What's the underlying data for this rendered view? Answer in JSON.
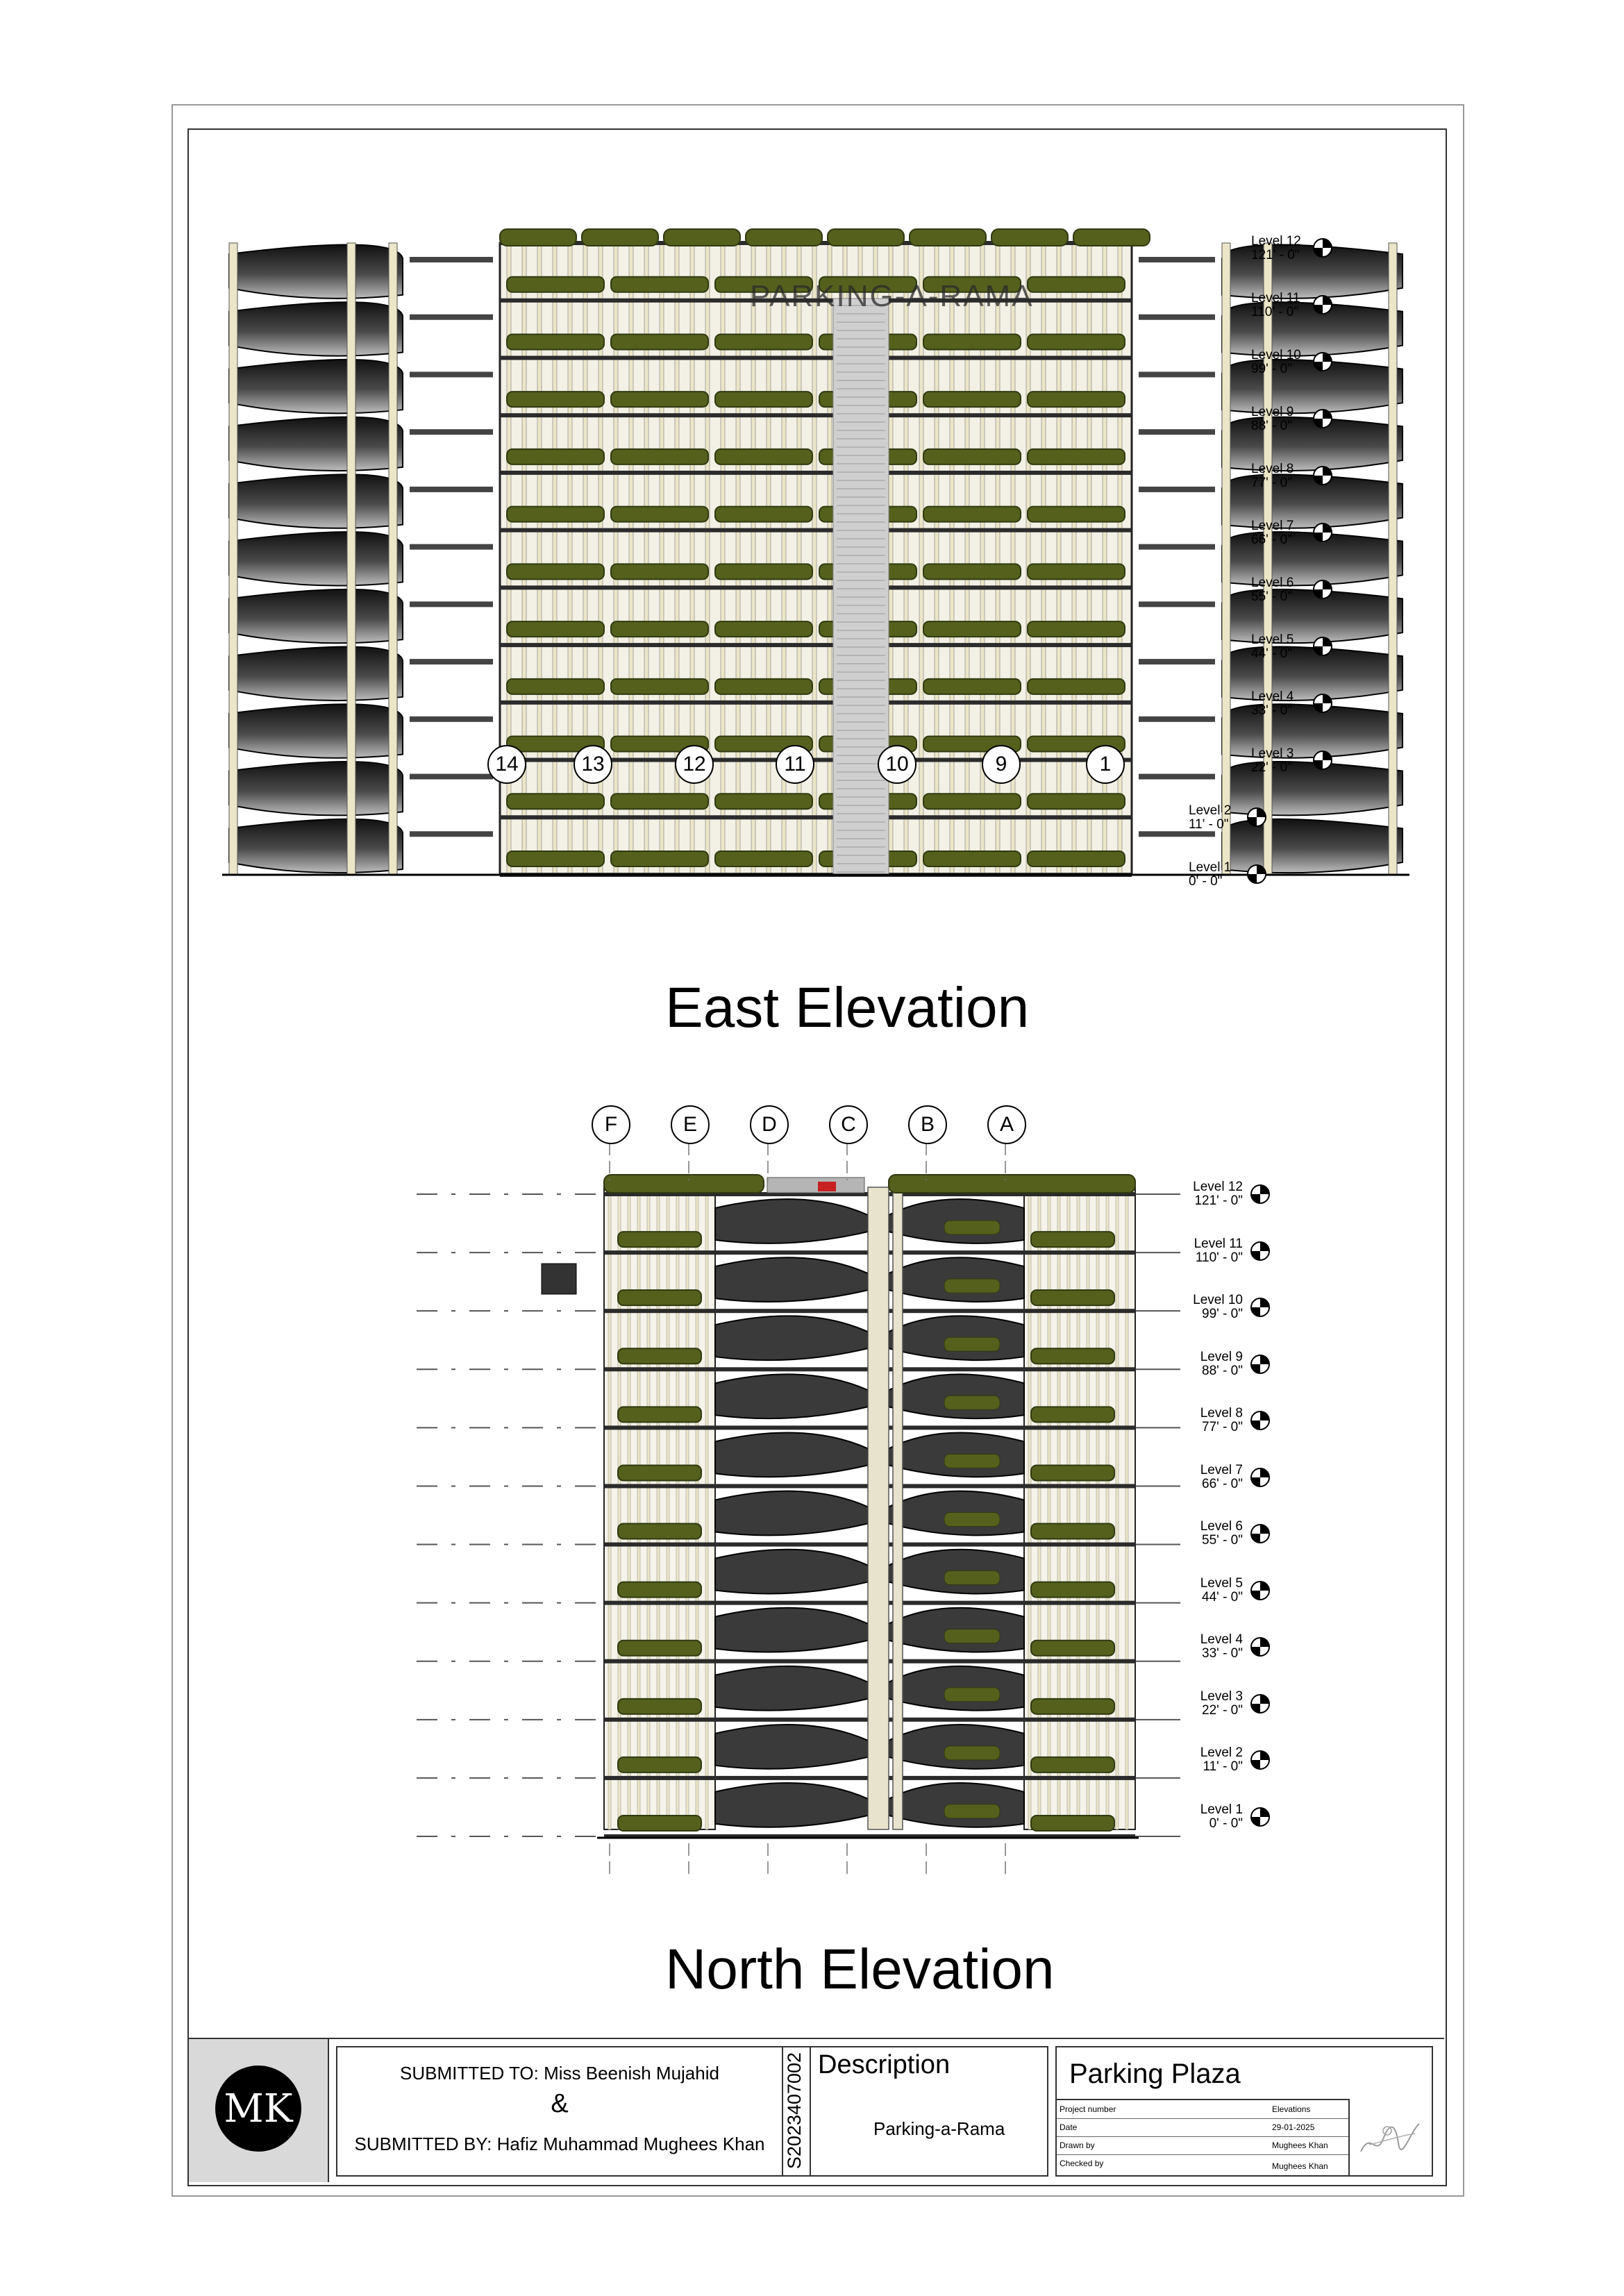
{
  "sheet": {
    "name": "Parking Plaza"
  },
  "east_elevation": {
    "title": "East Elevation",
    "signage": "PARKING-A-RAMA",
    "grid_labels": [
      "14",
      "13",
      "12",
      "11",
      "10",
      "9",
      "1"
    ],
    "levels": [
      {
        "name": "Level 12",
        "elev": "121' - 0\""
      },
      {
        "name": "Level 11",
        "elev": "110' - 0\""
      },
      {
        "name": "Level 10",
        "elev": "99' - 0\""
      },
      {
        "name": "Level 9",
        "elev": "88' - 0\""
      },
      {
        "name": "Level 8",
        "elev": "77' - 0\""
      },
      {
        "name": "Level 7",
        "elev": "66' - 0\""
      },
      {
        "name": "Level 6",
        "elev": "55' - 0\""
      },
      {
        "name": "Level 5",
        "elev": "44' - 0\""
      },
      {
        "name": "Level 4",
        "elev": "33' - 0\""
      },
      {
        "name": "Level 3",
        "elev": "22' - 0\""
      },
      {
        "name": "Level 2",
        "elev": "11' - 0\""
      },
      {
        "name": "Level 1",
        "elev": "0' - 0\""
      }
    ]
  },
  "north_elevation": {
    "title": "North Elevation",
    "grid_labels": [
      "F",
      "E",
      "D",
      "C",
      "B",
      "A"
    ],
    "levels": [
      {
        "name": "Level 12",
        "elev": "121' - 0\""
      },
      {
        "name": "Level 11",
        "elev": "110' - 0\""
      },
      {
        "name": "Level 10",
        "elev": "99' - 0\""
      },
      {
        "name": "Level 9",
        "elev": "88' - 0\""
      },
      {
        "name": "Level 8",
        "elev": "77' - 0\""
      },
      {
        "name": "Level 7",
        "elev": "66' - 0\""
      },
      {
        "name": "Level 6",
        "elev": "55' - 0\""
      },
      {
        "name": "Level 5",
        "elev": "44' - 0\""
      },
      {
        "name": "Level 4",
        "elev": "33' - 0\""
      },
      {
        "name": "Level 3",
        "elev": "22' - 0\""
      },
      {
        "name": "Level 2",
        "elev": "11' - 0\""
      },
      {
        "name": "Level 1",
        "elev": "0' - 0\""
      }
    ]
  },
  "title_block": {
    "logo_text": "MK",
    "submitted_to": "SUBMITTED TO: Miss Beenish Mujahid",
    "ampersand": "&",
    "submitted_by": "SUBMITTED BY: Hafiz Muhammad Mughees Khan",
    "student_id": "S2023407002",
    "description_label": "Description",
    "description_value": "Parking-a-Rama",
    "project_name": "Parking Plaza",
    "fields": [
      {
        "label": "Project number",
        "value": "Elevations"
      },
      {
        "label": "Date",
        "value": "29-01-2025"
      },
      {
        "label": "Drawn by",
        "value": "Mughees Khan"
      },
      {
        "label": "Checked by",
        "value": "Mughees Khan"
      }
    ]
  },
  "colors": {
    "frame_dark": "#1e1e1e",
    "slab": "#2b2b2b",
    "column": "#ece6c8",
    "planter": "#55601d",
    "planter_dark": "#2f3a10",
    "ramp": "#3a3a3a"
  }
}
